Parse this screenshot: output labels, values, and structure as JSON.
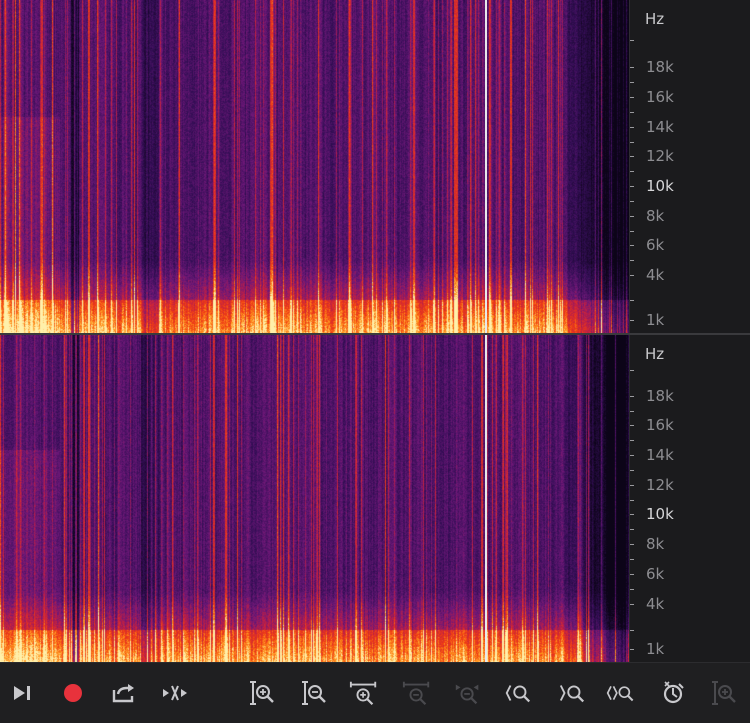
{
  "channels": [
    {
      "name": "top",
      "unit": "Hz",
      "freq_labels": [
        "18k",
        "16k",
        "14k",
        "12k",
        "10k",
        "8k",
        "6k",
        "4k",
        "1k"
      ]
    },
    {
      "name": "bottom",
      "unit": "Hz",
      "freq_labels": [
        "18k",
        "16k",
        "14k",
        "12k",
        "10k",
        "8k",
        "6k",
        "4k",
        "1k"
      ]
    }
  ],
  "colors": {
    "background": "#1d1d1f",
    "record": "#e8323c",
    "icon": "#c8c8cc",
    "icon_disabled": "#4a4a4e",
    "playhead": "#e8e8ea"
  },
  "toolbar": {
    "buttons": [
      {
        "icon": "skip-to-end-icon",
        "enabled": true
      },
      {
        "icon": "record-icon",
        "enabled": true
      },
      {
        "icon": "export-icon",
        "enabled": true
      },
      {
        "icon": "skip-selection-icon",
        "enabled": true
      },
      {
        "icon": "zoom-in-amplitude-icon",
        "enabled": true
      },
      {
        "icon": "zoom-out-amplitude-icon",
        "enabled": true
      },
      {
        "icon": "zoom-in-time-icon",
        "enabled": true
      },
      {
        "icon": "zoom-out-full-icon",
        "enabled": false
      },
      {
        "icon": "zoom-to-selection-icon",
        "enabled": false
      },
      {
        "icon": "zoom-in-to-in-point-icon",
        "enabled": true
      },
      {
        "icon": "zoom-in-to-out-point-icon",
        "enabled": true
      },
      {
        "icon": "zoom-to-selection-bounds-icon",
        "enabled": true
      },
      {
        "icon": "zoom-reset-icon",
        "enabled": true
      },
      {
        "icon": "zoom-in-vertical-icon",
        "enabled": false
      }
    ]
  }
}
